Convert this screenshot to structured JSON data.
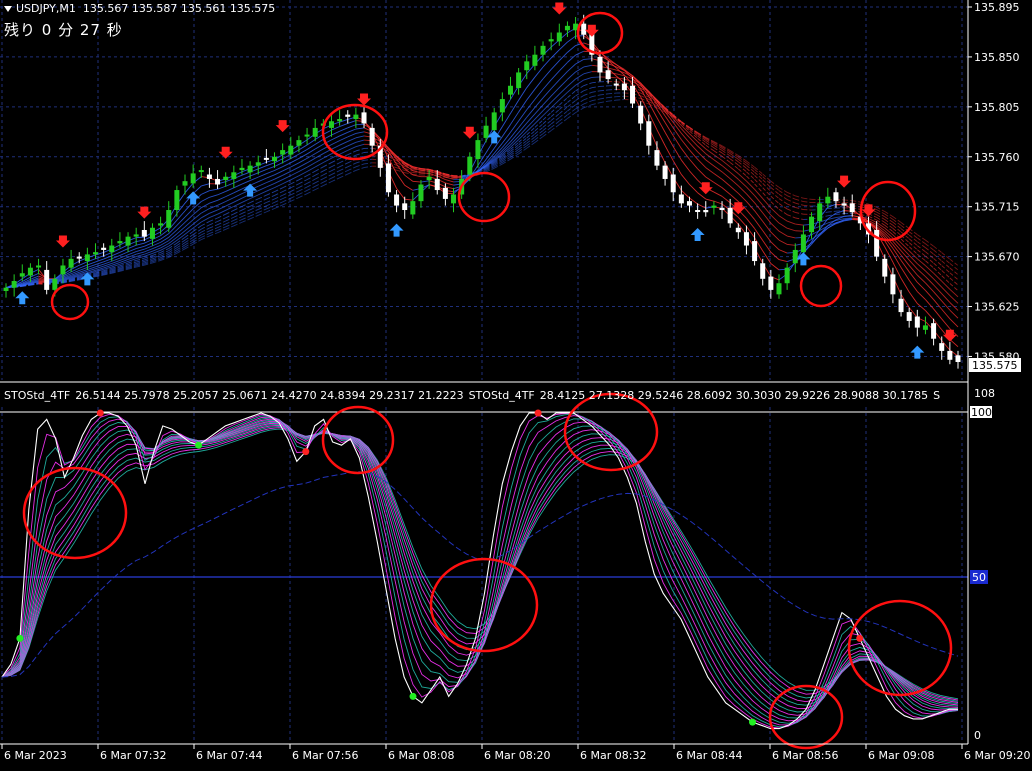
{
  "header": {
    "symbol_label": "USDJPY,M1",
    "ohlc": "135.567 135.587 135.561 135.575",
    "countdown": "残り 0 分 27 秒"
  },
  "indicator_header": {
    "name1": "STOStd_4TF",
    "values1": "26.5144 25.7978 25.2057 25.0671 24.4270 24.8394 29.2317 21.2223",
    "name2": "STOStd_4TF",
    "values2": "28.4125 27.1328 29.5246 28.6092 30.3030 29.9226 28.9088 30.1785",
    "tail": "S"
  },
  "price_axis": {
    "ticks": [
      "135.895",
      "135.850",
      "135.805",
      "135.760",
      "135.715",
      "135.670",
      "135.625",
      "135.580"
    ],
    "current_price": "135.575",
    "current_price_color": "#ffffff"
  },
  "indicator_axis": {
    "ticks": [
      "108",
      "100",
      "50",
      "0"
    ],
    "mid_marker": "50"
  },
  "time_axis": {
    "ticks": [
      "6 Mar 2023",
      "6 Mar 07:32",
      "6 Mar 07:44",
      "6 Mar 07:56",
      "6 Mar 08:08",
      "6 Mar 08:20",
      "6 Mar 08:32",
      "6 Mar 08:44",
      "6 Mar 08:56",
      "6 Mar 09:08",
      "6 Mar 09:20"
    ]
  },
  "colors": {
    "background": "#000000",
    "grid": "#1f2f7a",
    "bull_candle": "#22cc22",
    "bear_candle": "#ffffff",
    "up_arrow": "#3399ff",
    "down_arrow": "#ff2020",
    "circle": "#ff1010",
    "ribbon_up": "#3366ff",
    "ribbon_down": "#ff3030",
    "sto_main": "#ffffff",
    "sto_fan_a": "#ff33ff",
    "sto_fan_b": "#22bbaa",
    "signal_green": "#22ee22",
    "signal_red": "#ff2222",
    "level_line": "#2233cc"
  },
  "chart_data": [
    {
      "type": "candlestick",
      "title": "USDJPY,M1",
      "ylim": [
        135.575,
        135.895
      ],
      "y_ticks": [
        135.895,
        135.85,
        135.805,
        135.76,
        135.715,
        135.67,
        135.625,
        135.58
      ],
      "x_ticks": [
        "6 Mar 2023",
        "6 Mar 07:32",
        "6 Mar 07:44",
        "6 Mar 07:56",
        "6 Mar 08:08",
        "6 Mar 08:20",
        "6 Mar 08:32",
        "6 Mar 08:44",
        "6 Mar 08:56",
        "6 Mar 09:08",
        "6 Mar 09:20"
      ],
      "close_path": [
        135.642,
        135.648,
        135.655,
        135.66,
        135.662,
        135.64,
        135.65,
        135.662,
        135.668,
        135.67,
        135.672,
        135.674,
        135.676,
        135.68,
        135.684,
        135.688,
        135.69,
        135.688,
        135.696,
        135.7,
        135.712,
        135.73,
        135.738,
        135.745,
        135.748,
        135.74,
        135.735,
        135.742,
        135.746,
        135.75,
        135.752,
        135.755,
        135.758,
        135.76,
        135.766,
        135.77,
        135.775,
        135.78,
        135.786,
        135.79,
        135.792,
        135.794,
        135.796,
        135.798,
        135.79,
        135.77,
        135.75,
        135.728,
        135.716,
        135.712,
        135.72,
        135.735,
        135.742,
        135.73,
        135.722,
        135.726,
        135.74,
        135.76,
        135.775,
        135.788,
        135.8,
        135.812,
        135.824,
        135.836,
        135.846,
        135.852,
        135.86,
        135.866,
        135.872,
        135.878,
        135.88,
        135.87,
        135.852,
        135.836,
        135.83,
        135.826,
        135.82,
        135.808,
        135.79,
        135.77,
        135.752,
        135.74,
        135.728,
        135.718,
        135.716,
        135.712,
        135.71,
        135.716,
        135.712,
        135.7,
        135.692,
        135.68,
        135.666,
        135.65,
        135.64,
        135.646,
        135.66,
        135.676,
        135.69,
        135.706,
        135.718,
        135.724,
        135.72,
        135.716,
        135.71,
        135.7,
        135.69,
        135.67,
        135.652,
        135.636,
        135.62,
        135.612,
        135.606,
        135.608,
        135.596,
        135.585,
        135.577,
        135.575
      ]
    },
    {
      "type": "line",
      "title": "STOStd_4TF",
      "ylim": [
        0,
        108
      ],
      "y_ticks": [
        108,
        100,
        50,
        0
      ],
      "series": [
        {
          "values": [
            18,
            22,
            30,
            70,
            95,
            98,
            92,
            80,
            86,
            93,
            98,
            100,
            100,
            99,
            96,
            90,
            78,
            88,
            96,
            95,
            93,
            91,
            90,
            92,
            94,
            96,
            97,
            98,
            99,
            100,
            99,
            97,
            92,
            85,
            88,
            96,
            98,
            91,
            90,
            92,
            86,
            74,
            60,
            45,
            30,
            18,
            12,
            10,
            14,
            18,
            12,
            16,
            22,
            30,
            44,
            62,
            78,
            88,
            96,
            100,
            100,
            98,
            100,
            100,
            100,
            98,
            96,
            93,
            90,
            86,
            80,
            72,
            60,
            50,
            44,
            40,
            36,
            30,
            24,
            18,
            14,
            10,
            8,
            6,
            4,
            3,
            2,
            2,
            3,
            5,
            8,
            14,
            22,
            30,
            38,
            36,
            30,
            24,
            18,
            12,
            8,
            6,
            5,
            5,
            6,
            7,
            8,
            8
          ]
        }
      ]
    }
  ]
}
